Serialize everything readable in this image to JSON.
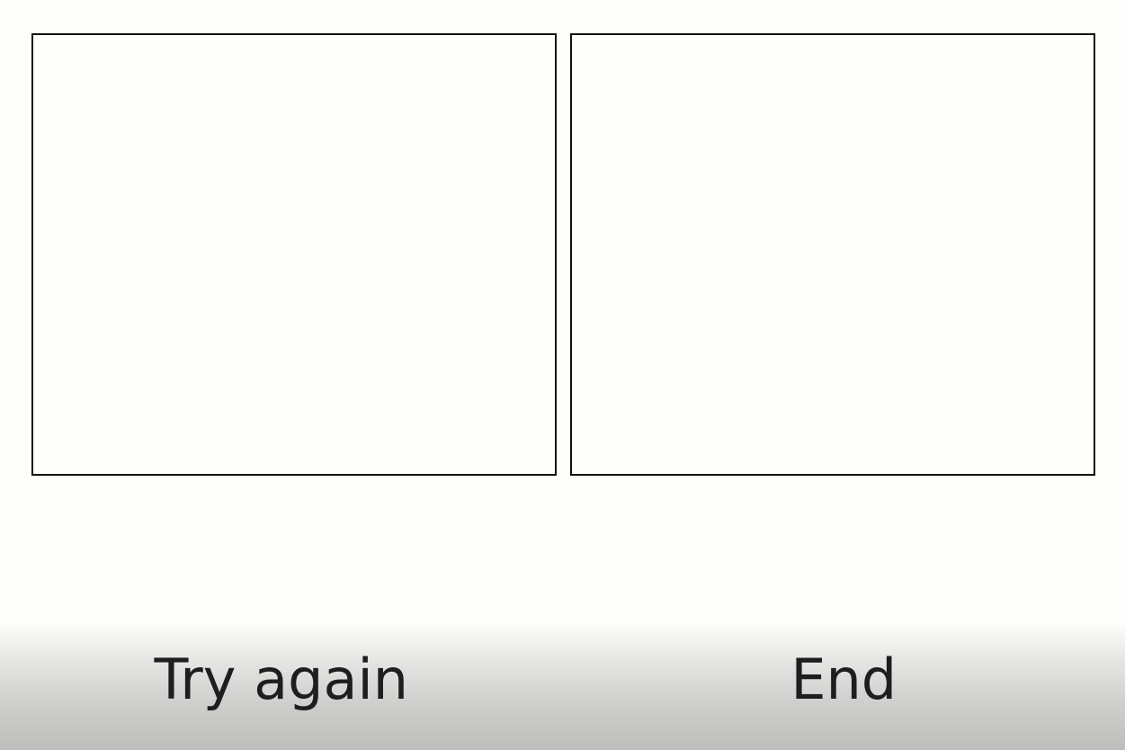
{
  "panels": [
    {
      "id": "left",
      "content": ""
    },
    {
      "id": "right",
      "content": ""
    }
  ],
  "actions": {
    "try_again_label": "Try again",
    "end_label": "End"
  },
  "colors": {
    "background": "#fefefa",
    "panel_border": "#111111",
    "bar_gradient_top": "#fdfdf9",
    "bar_gradient_bottom": "#bdbdbb",
    "text": "#1e1e1e"
  }
}
